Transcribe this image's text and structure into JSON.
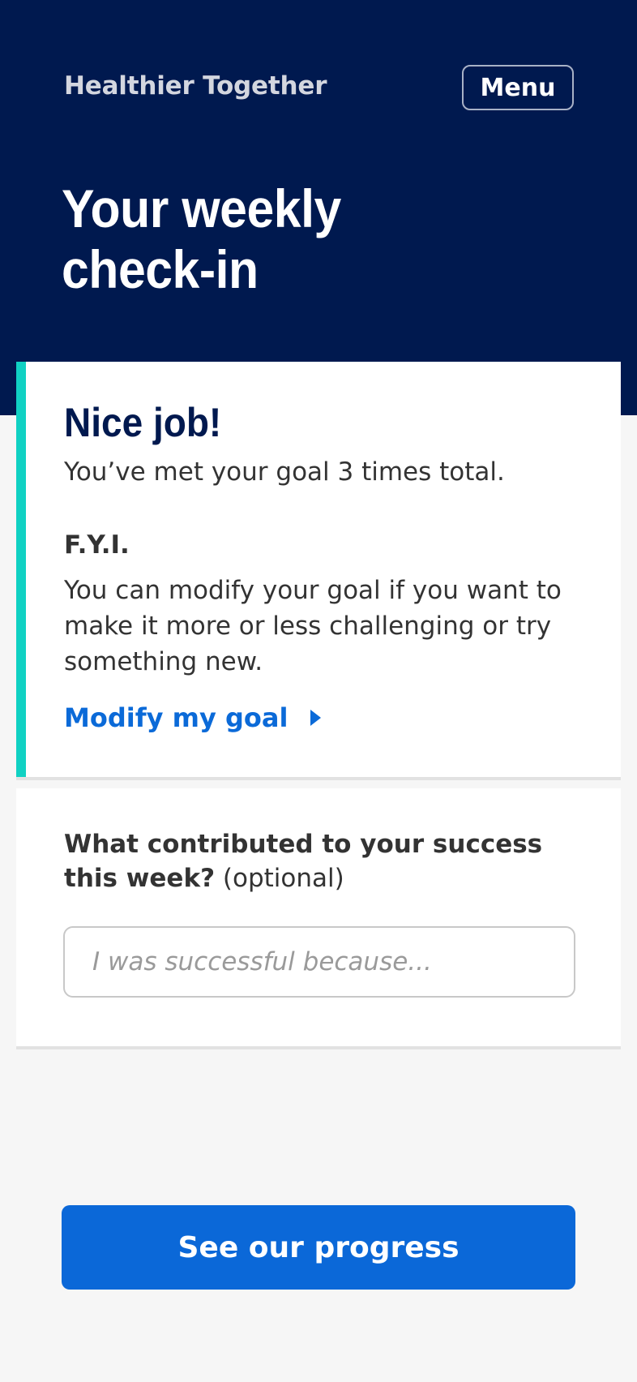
{
  "header": {
    "brand": "Healthier Together",
    "menu_label": "Menu",
    "title": "Your weekly check-in"
  },
  "success_card": {
    "heading": "Nice job!",
    "goal_met_text": "You’ve met your goal 3 times total.",
    "fyi_label": "F.Y.I.",
    "fyi_text": "You can modify your goal if you want to make it more or less challenging or try something new.",
    "modify_link": "Modify my goal"
  },
  "reflection_card": {
    "question": "What contributed to your success this week?",
    "optional_tag": "(optional)",
    "input_value": "",
    "input_placeholder": "I was successful because..."
  },
  "cta": {
    "label": "See our progress"
  },
  "colors": {
    "header_bg": "#00194f",
    "accent_teal": "#10d1c3",
    "link_blue": "#0b6ad8",
    "button_blue": "#0b68d8"
  },
  "icons": {
    "modify_link_icon": "caret-right-icon"
  }
}
